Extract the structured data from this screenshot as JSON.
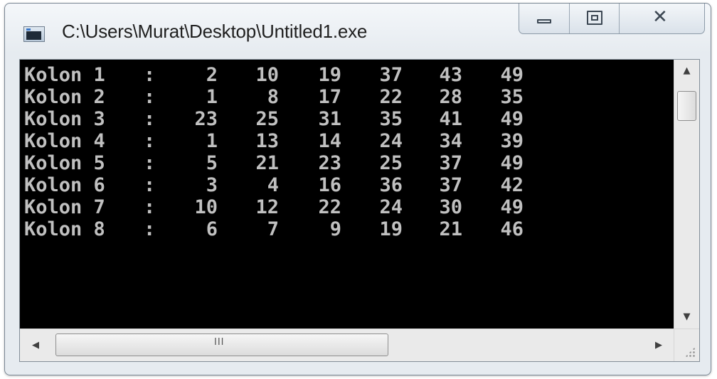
{
  "window": {
    "title": "C:\\Users\\Murat\\Desktop\\Untitled1.exe"
  },
  "icons": {
    "app": "console-app-icon",
    "minimize": "minimize-icon",
    "maximize": "maximize-icon",
    "close": "close-icon",
    "scroll_up": "arrow-up-icon",
    "scroll_down": "arrow-down-icon",
    "scroll_left": "arrow-left-icon",
    "scroll_right": "arrow-right-icon",
    "grip": "scroll-grip-icon",
    "size_grip": "resize-grip-icon"
  },
  "scroll": {
    "grip_text": "III",
    "up_glyph": "▲",
    "down_glyph": "▼",
    "left_glyph": "◀",
    "right_glyph": "▶"
  },
  "caption": {
    "close_glyph": "✕"
  },
  "console": {
    "colon": ":",
    "rows": [
      {
        "label": "Kolon 1",
        "numbers": [
          "2",
          "10",
          "19",
          "37",
          "43",
          "49"
        ]
      },
      {
        "label": "Kolon 2",
        "numbers": [
          "1",
          "8",
          "17",
          "22",
          "28",
          "35"
        ]
      },
      {
        "label": "Kolon 3",
        "numbers": [
          "23",
          "25",
          "31",
          "35",
          "41",
          "49"
        ]
      },
      {
        "label": "Kolon 4",
        "numbers": [
          "1",
          "13",
          "14",
          "24",
          "34",
          "39"
        ]
      },
      {
        "label": "Kolon 5",
        "numbers": [
          "5",
          "21",
          "23",
          "25",
          "37",
          "49"
        ]
      },
      {
        "label": "Kolon 6",
        "numbers": [
          "3",
          "4",
          "16",
          "36",
          "37",
          "42"
        ]
      },
      {
        "label": "Kolon 7",
        "numbers": [
          "10",
          "12",
          "22",
          "24",
          "30",
          "49"
        ]
      },
      {
        "label": "Kolon 8",
        "numbers": [
          "6",
          "7",
          "9",
          "19",
          "21",
          "46"
        ]
      }
    ]
  },
  "colors": {
    "console_bg": "#000000",
    "console_text": "#c0c0c0",
    "frame": "#e6ebf0"
  }
}
